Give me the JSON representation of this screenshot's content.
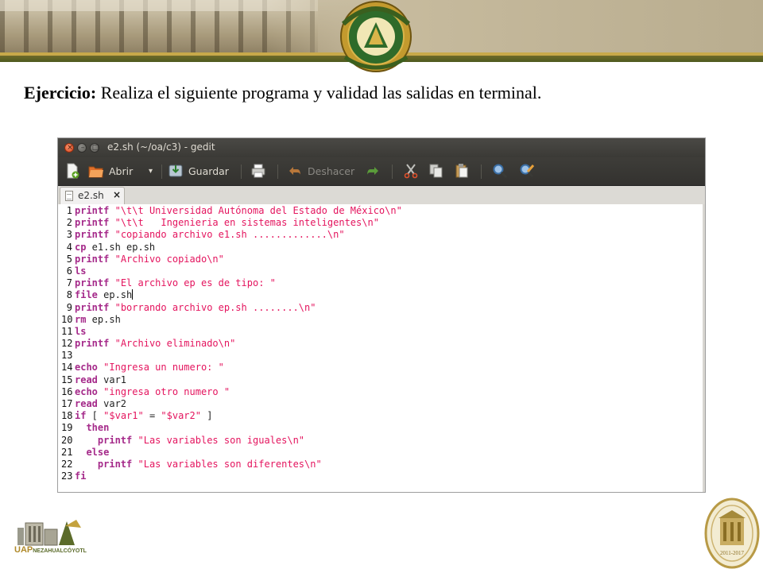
{
  "slide": {
    "title_bold": "Ejercicio:",
    "title_rest": " Realiza el siguiente programa y validad las salidas en terminal."
  },
  "window": {
    "title": "e2.sh (~/oa/c3) - gedit",
    "buttons": {
      "close": "×",
      "minimize": "–",
      "maximize": "□"
    }
  },
  "toolbar": {
    "new_icon": "new-document-icon",
    "open_label": "Abrir",
    "open_dropdown": "▾",
    "save_label": "Guardar",
    "print_icon": "print-icon",
    "undo_label": "Deshacer",
    "redo_icon": "redo-icon",
    "cut_icon": "cut-icon",
    "copy_icon": "copy-icon",
    "paste_icon": "paste-icon",
    "find_icon": "search-icon",
    "replace_icon": "find-replace-icon"
  },
  "tab": {
    "label": "e2.sh",
    "close": "×"
  },
  "editor": {
    "lines": [
      {
        "n": "1",
        "parts": [
          {
            "t": "kw",
            "v": "printf"
          },
          {
            "t": "txt",
            "v": " "
          },
          {
            "t": "str",
            "v": "\"\\t\\t Universidad Autónoma del Estado de México\\n\""
          }
        ]
      },
      {
        "n": "2",
        "parts": [
          {
            "t": "kw",
            "v": "printf"
          },
          {
            "t": "txt",
            "v": " "
          },
          {
            "t": "str",
            "v": "\"\\t\\t   Ingenieria en sistemas inteligentes\\n\""
          }
        ]
      },
      {
        "n": "3",
        "parts": [
          {
            "t": "kw",
            "v": "printf"
          },
          {
            "t": "txt",
            "v": " "
          },
          {
            "t": "str",
            "v": "\"copiando archivo e1.sh .............\\n\""
          }
        ]
      },
      {
        "n": "4",
        "parts": [
          {
            "t": "kw",
            "v": "cp"
          },
          {
            "t": "txt",
            "v": " e1.sh ep.sh"
          }
        ]
      },
      {
        "n": "5",
        "parts": [
          {
            "t": "kw",
            "v": "printf"
          },
          {
            "t": "txt",
            "v": " "
          },
          {
            "t": "str",
            "v": "\"Archivo copiado\\n\""
          }
        ]
      },
      {
        "n": "6",
        "parts": [
          {
            "t": "kw",
            "v": "ls"
          }
        ]
      },
      {
        "n": "7",
        "parts": [
          {
            "t": "kw",
            "v": "printf"
          },
          {
            "t": "txt",
            "v": " "
          },
          {
            "t": "str",
            "v": "\"El archivo ep es de tipo: \""
          }
        ]
      },
      {
        "n": "8",
        "parts": [
          {
            "t": "kw",
            "v": "file"
          },
          {
            "t": "txt",
            "v": " ep.sh"
          }
        ],
        "caret": true
      },
      {
        "n": "9",
        "parts": [
          {
            "t": "kw",
            "v": "printf"
          },
          {
            "t": "txt",
            "v": " "
          },
          {
            "t": "str",
            "v": "\"borrando archivo ep.sh ........\\n\""
          }
        ]
      },
      {
        "n": "10",
        "parts": [
          {
            "t": "kw",
            "v": "rm"
          },
          {
            "t": "txt",
            "v": " ep.sh"
          }
        ]
      },
      {
        "n": "11",
        "parts": [
          {
            "t": "kw",
            "v": "ls"
          }
        ]
      },
      {
        "n": "12",
        "parts": [
          {
            "t": "kw",
            "v": "printf"
          },
          {
            "t": "txt",
            "v": " "
          },
          {
            "t": "str",
            "v": "\"Archivo eliminado\\n\""
          }
        ]
      },
      {
        "n": "13",
        "parts": []
      },
      {
        "n": "14",
        "parts": [
          {
            "t": "kw",
            "v": "echo"
          },
          {
            "t": "txt",
            "v": " "
          },
          {
            "t": "str",
            "v": "\"Ingresa un numero: \""
          }
        ]
      },
      {
        "n": "15",
        "parts": [
          {
            "t": "kw",
            "v": "read"
          },
          {
            "t": "txt",
            "v": " var1"
          }
        ]
      },
      {
        "n": "16",
        "parts": [
          {
            "t": "kw",
            "v": "echo"
          },
          {
            "t": "txt",
            "v": " "
          },
          {
            "t": "str",
            "v": "\"ingresa otro numero \""
          }
        ]
      },
      {
        "n": "17",
        "parts": [
          {
            "t": "kw",
            "v": "read"
          },
          {
            "t": "txt",
            "v": " var2"
          }
        ]
      },
      {
        "n": "18",
        "parts": [
          {
            "t": "kw",
            "v": "if"
          },
          {
            "t": "txt",
            "v": " [ "
          },
          {
            "t": "str",
            "v": "\"$var1\""
          },
          {
            "t": "txt",
            "v": " = "
          },
          {
            "t": "str",
            "v": "\"$var2\""
          },
          {
            "t": "txt",
            "v": " ]"
          }
        ]
      },
      {
        "n": "19",
        "parts": [
          {
            "t": "txt",
            "v": "  "
          },
          {
            "t": "kw",
            "v": "then"
          }
        ]
      },
      {
        "n": "20",
        "parts": [
          {
            "t": "txt",
            "v": "    "
          },
          {
            "t": "kw",
            "v": "printf"
          },
          {
            "t": "txt",
            "v": " "
          },
          {
            "t": "str",
            "v": "\"Las variables son iguales\\n\""
          }
        ]
      },
      {
        "n": "21",
        "parts": [
          {
            "t": "txt",
            "v": "  "
          },
          {
            "t": "kw",
            "v": "else"
          }
        ]
      },
      {
        "n": "22",
        "parts": [
          {
            "t": "txt",
            "v": "    "
          },
          {
            "t": "kw",
            "v": "printf"
          },
          {
            "t": "txt",
            "v": " "
          },
          {
            "t": "str",
            "v": "\"Las variables son diferentes\\n\""
          }
        ]
      },
      {
        "n": "23",
        "parts": [
          {
            "t": "kw",
            "v": "fi"
          }
        ]
      }
    ]
  },
  "footer": {
    "uap_logo_text": "UAP",
    "uap_logo_sub": "NEZAHUALCÓYOTL",
    "medal_years": "2011-2017"
  },
  "colors": {
    "keyword": "#a52a8a",
    "string": "#e4145e",
    "titlebar": "#3c3b37",
    "banner_gold": "#c8a94a",
    "banner_green": "#4d5a1e"
  }
}
